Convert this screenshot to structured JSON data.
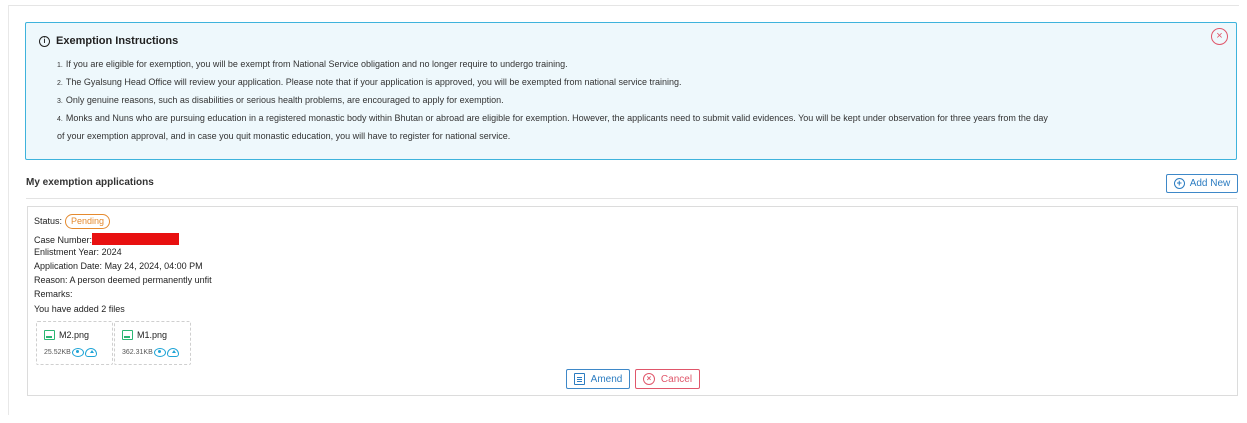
{
  "instructions": {
    "title": "Exemption Instructions",
    "close_icon": "×",
    "items": [
      {
        "num": "1.",
        "text": "If you are eligible for exemption, you will be exempt from National Service obligation and no longer require to undergo training."
      },
      {
        "num": "2.",
        "text": "The Gyalsung Head Office will review your application. Please note that if your application is approved, you will be exempted from national service training."
      },
      {
        "num": "3.",
        "text": "Only genuine reasons, such as disabilities or serious health problems, are encouraged to apply for exemption."
      },
      {
        "num": "4.",
        "text": "Monks and Nuns who are pursuing education in a registered monastic body within Bhutan or abroad are eligible for exemption. However, the applicants need to submit valid evidences. You will be kept under observation for three years from the day",
        "cont": "of your exemption approval, and in case you quit monastic education, you will have to register for national service."
      }
    ]
  },
  "section": {
    "title": "My exemption applications",
    "add_new_label": "Add New"
  },
  "application": {
    "status_label": "Status:",
    "status_value": "Pending",
    "case_number_label": "Case Number:",
    "enlistment_year_label": "Enlistment Year:",
    "enlistment_year_value": "2024",
    "application_date_label": "Application Date:",
    "application_date_value": "May 24, 2024, 04:00 PM",
    "reason_label": "Reason:",
    "reason_value": "A person deemed permanently unfit",
    "remarks_label": "Remarks:",
    "files_summary": "You have added 2 files",
    "files": [
      {
        "name": "M2.png",
        "size": "25.52KB"
      },
      {
        "name": "M1.png",
        "size": "362.31KB"
      }
    ],
    "amend_label": "Amend",
    "cancel_label": "Cancel"
  },
  "colors": {
    "info_border": "#3eb3dc",
    "info_bg": "#eef8fc",
    "primary": "#2b7cc1",
    "danger": "#e0566a",
    "warning": "#e58a2e",
    "redaction": "#e81010"
  },
  "icons": {
    "info": "info-circle-icon",
    "close": "close-circle-icon",
    "add": "plus-circle-icon",
    "file": "image-file-icon",
    "view": "eye-icon",
    "download": "cloud-download-icon",
    "amend": "document-icon",
    "cancel": "x-circle-icon"
  }
}
